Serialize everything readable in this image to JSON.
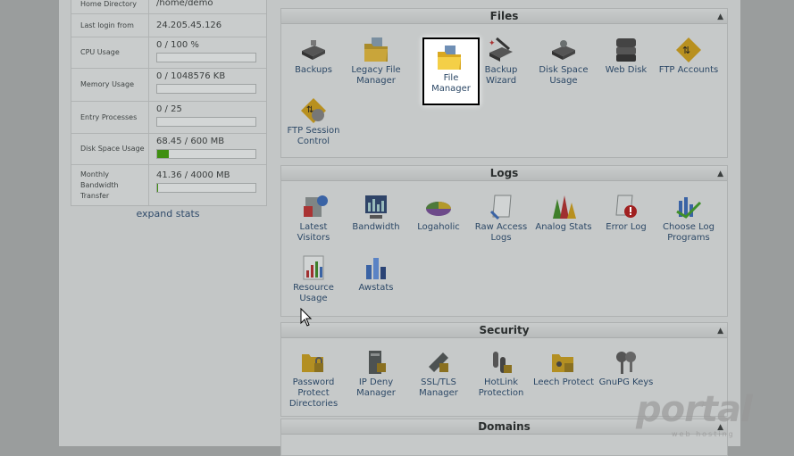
{
  "stats": [
    {
      "label": "Home Directory",
      "value": "/home/demo"
    },
    {
      "label": "Last login from",
      "value": "24.205.45.126"
    },
    {
      "label": "CPU Usage",
      "value": "0 / 100 %",
      "fill": 0
    },
    {
      "label": "Memory Usage",
      "value": "0 / 1048576 KB",
      "fill": 0
    },
    {
      "label": "Entry Processes",
      "value": "0 / 25",
      "fill": 0
    },
    {
      "label": "Disk Space Usage",
      "value": "68.45 / 600 MB",
      "fill": 0.114
    },
    {
      "label": "Monthly Bandwidth Transfer",
      "value": "41.36 / 4000 MB",
      "fill": 0.01
    }
  ],
  "expand_stats": "expand stats",
  "sections": {
    "files": {
      "title": "Files",
      "items": [
        "Backups",
        "Legacy File Manager",
        "File Manager",
        "Backup Wizard",
        "Disk Space Usage",
        "Web Disk",
        "FTP Accounts",
        "FTP Session Control"
      ]
    },
    "logs": {
      "title": "Logs",
      "items": [
        "Latest Visitors",
        "Bandwidth",
        "Logaholic",
        "Raw Access Logs",
        "Analog Stats",
        "Error Log",
        "Choose Log Programs",
        "Resource Usage",
        "Awstats"
      ]
    },
    "security": {
      "title": "Security",
      "items": [
        "Password Protect Directories",
        "IP Deny Manager",
        "SSL/TLS Manager",
        "HotLink Protection",
        "Leech Protect",
        "GnuPG Keys"
      ]
    },
    "domains": {
      "title": "Domains"
    }
  },
  "watermark": {
    "text": "portal",
    "sub": "web hosting"
  },
  "colors": {
    "progress_fill": "#3f8f11",
    "link": "#2c4866"
  }
}
